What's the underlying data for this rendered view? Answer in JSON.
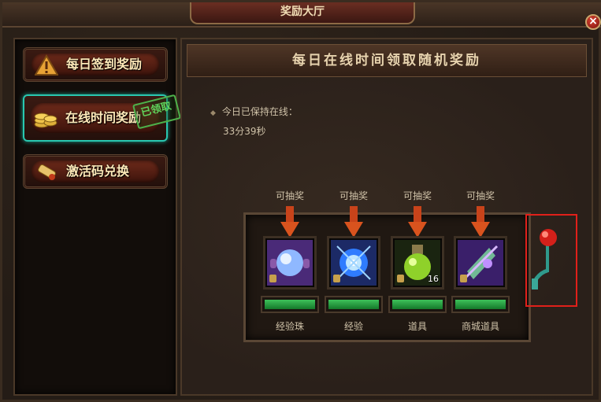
{
  "window": {
    "title": "奖励大厅",
    "close_label": "×"
  },
  "sidebar": {
    "items": [
      {
        "label": "每日签到奖励",
        "icon": "warning-triangle-icon",
        "active": false
      },
      {
        "label": "在线时间奖励",
        "icon": "gold-coins-icon",
        "active": true,
        "stamp": "已领取"
      },
      {
        "label": "激活码兑换",
        "icon": "scroll-icon",
        "active": false
      }
    ]
  },
  "main": {
    "header": "每日在线时间领取随机奖励",
    "online_label": "今日已保持在线：",
    "online_time": "33分39秒",
    "slots": [
      {
        "status": "可抽奖",
        "name": "经验珠",
        "icon": "exp-orb-icon",
        "qty": ""
      },
      {
        "status": "可抽奖",
        "name": "经验",
        "icon": "exp-burst-icon",
        "qty": ""
      },
      {
        "status": "可抽奖",
        "name": "道具",
        "icon": "potion-flask-icon",
        "qty": "16"
      },
      {
        "status": "可抽奖",
        "name": "商城道具",
        "icon": "mall-item-icon",
        "qty": ""
      }
    ],
    "lever": {
      "icon": "slot-lever-icon"
    }
  },
  "colors": {
    "accent_teal": "#29c7b0",
    "bar_green": "#3ec25a",
    "highlight_red": "#e0201a",
    "arrow_orange": "#d9531e"
  }
}
